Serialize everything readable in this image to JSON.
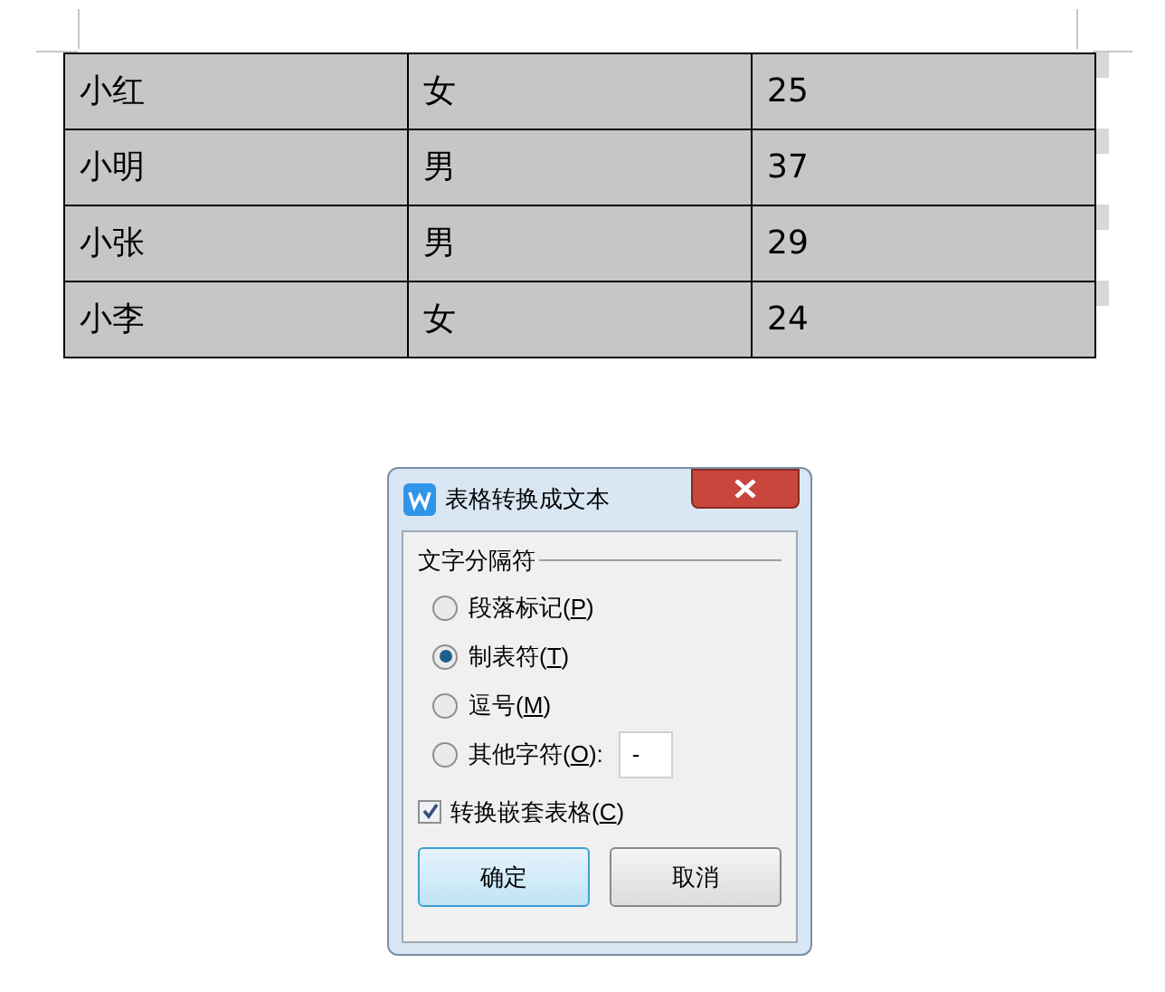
{
  "table": {
    "rows": [
      {
        "cells": [
          "小红",
          "女",
          "25"
        ]
      },
      {
        "cells": [
          "小明",
          "男",
          "37"
        ]
      },
      {
        "cells": [
          "小张",
          "男",
          "29"
        ]
      },
      {
        "cells": [
          "小李",
          "女",
          "24"
        ]
      }
    ]
  },
  "dialog": {
    "title": "表格转换成文本",
    "group_label": "文字分隔符",
    "options": [
      {
        "before": "段落标记(",
        "key": "P",
        "after": ")",
        "selected": false
      },
      {
        "before": "制表符(",
        "key": "T",
        "after": ")",
        "selected": true
      },
      {
        "before": "逗号(",
        "key": "M",
        "after": ")",
        "selected": false
      },
      {
        "before": "其他字符(",
        "key": "O",
        "after": "):",
        "selected": false,
        "value": "-"
      }
    ],
    "checkbox": {
      "before": "转换嵌套表格(",
      "key": "C",
      "after": ")",
      "checked": true
    },
    "buttons": [
      {
        "label": "确定",
        "kind": "default"
      },
      {
        "label": "取消",
        "kind": "normal"
      }
    ]
  }
}
